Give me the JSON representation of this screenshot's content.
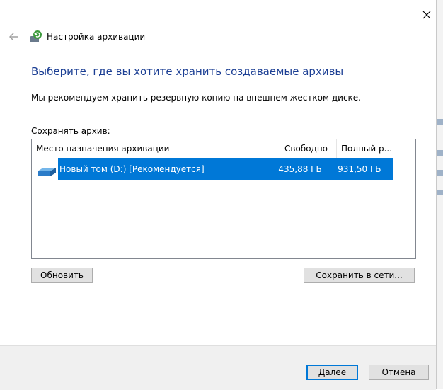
{
  "window": {
    "title": "Настройка архивации"
  },
  "main": {
    "heading": "Выберите, где вы хотите хранить создаваемые архивы",
    "description": "Мы рекомендуем хранить резервную копию на внешнем жестком диске.",
    "save_label": "Сохранять архив:"
  },
  "table": {
    "columns": [
      "Место назначения архивации",
      "Свободно",
      "Полный р..."
    ],
    "rows": [
      {
        "destination": "Новый том (D:) [Рекомендуется]",
        "free": "435,88 ГБ",
        "total": "931,50 ГБ",
        "selected": true
      }
    ]
  },
  "buttons": {
    "refresh": "Обновить",
    "save_network": "Сохранить в сети...",
    "next": "Далее",
    "cancel": "Отмена"
  },
  "colors": {
    "heading": "#1c3f94",
    "selection": "#0078d7"
  },
  "icons": {
    "back": "back-arrow-icon",
    "app": "backup-icon",
    "drive": "drive-icon",
    "close": "close-icon"
  }
}
